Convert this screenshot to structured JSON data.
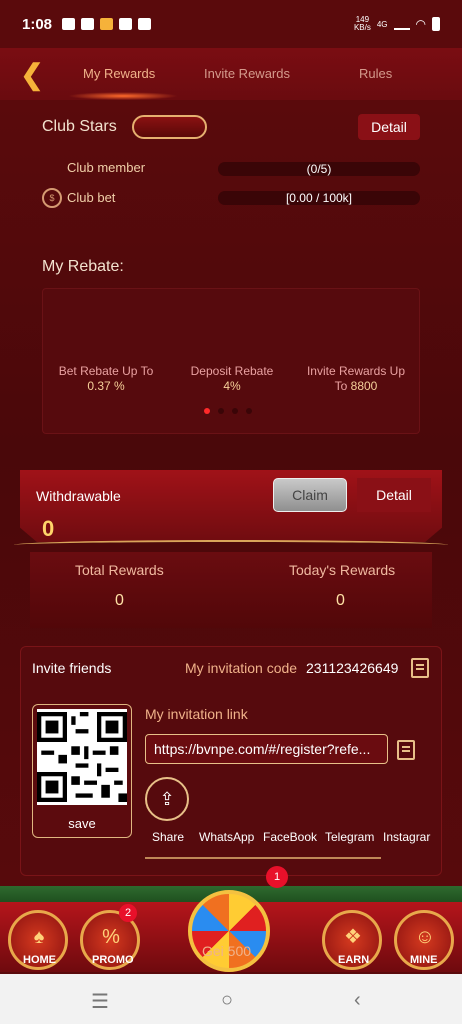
{
  "status_bar": {
    "time": "1:08",
    "net_speed_top": "149",
    "net_speed_bottom": "KB/s",
    "network": "4G"
  },
  "top_nav": {
    "tabs": [
      "My Rewards",
      "Invite Rewards",
      "Rules"
    ],
    "active_tab": 0
  },
  "club": {
    "title": "Club Stars",
    "detail_label": "Detail",
    "member_label": "Club member",
    "member_value": "(0/5)",
    "bet_label": "Club bet",
    "bet_value": "[0.00 / 100k]"
  },
  "rebate": {
    "title": "My Rebate:",
    "items": [
      {
        "label": "Bet Rebate Up To",
        "value": "0.37 %"
      },
      {
        "label": "Deposit Rebate",
        "value": "4%"
      },
      {
        "label": "Invite Rewards Up",
        "label2": "To",
        "value": "8800"
      }
    ],
    "page_count": 4,
    "current_page": 0
  },
  "withdraw": {
    "label": "Withdrawable",
    "value": "0",
    "claim_label": "Claim",
    "detail_label": "Detail"
  },
  "totals": {
    "total_label": "Total Rewards",
    "total_value": "0",
    "today_label": "Today's Rewards",
    "today_value": "0"
  },
  "invite": {
    "title": "Invite friends",
    "code_label": "My invitation code",
    "code_value": "231123426649",
    "link_label": "My invitation link",
    "link_value": "https://bvnpe.com/#/register?refe...",
    "qr_save_label": "save",
    "share_targets": [
      "Share",
      "WhatsApp",
      "FaceBook",
      "Telegram",
      "Instagrar"
    ]
  },
  "bottom_nav": {
    "items": [
      {
        "label": "HOME",
        "icon": "home-icon"
      },
      {
        "label": "PROMO",
        "icon": "promo-icon",
        "badge": "2"
      },
      {
        "label": "Gei 500",
        "icon": "wheel-icon",
        "badge": "1"
      },
      {
        "label": "EARN",
        "icon": "gift-icon"
      },
      {
        "label": "MINE",
        "icon": "mine-icon"
      }
    ]
  },
  "colors": {
    "background": "#5a0a0c",
    "accent": "#f6b23a",
    "detail_button": "#8a1016"
  }
}
